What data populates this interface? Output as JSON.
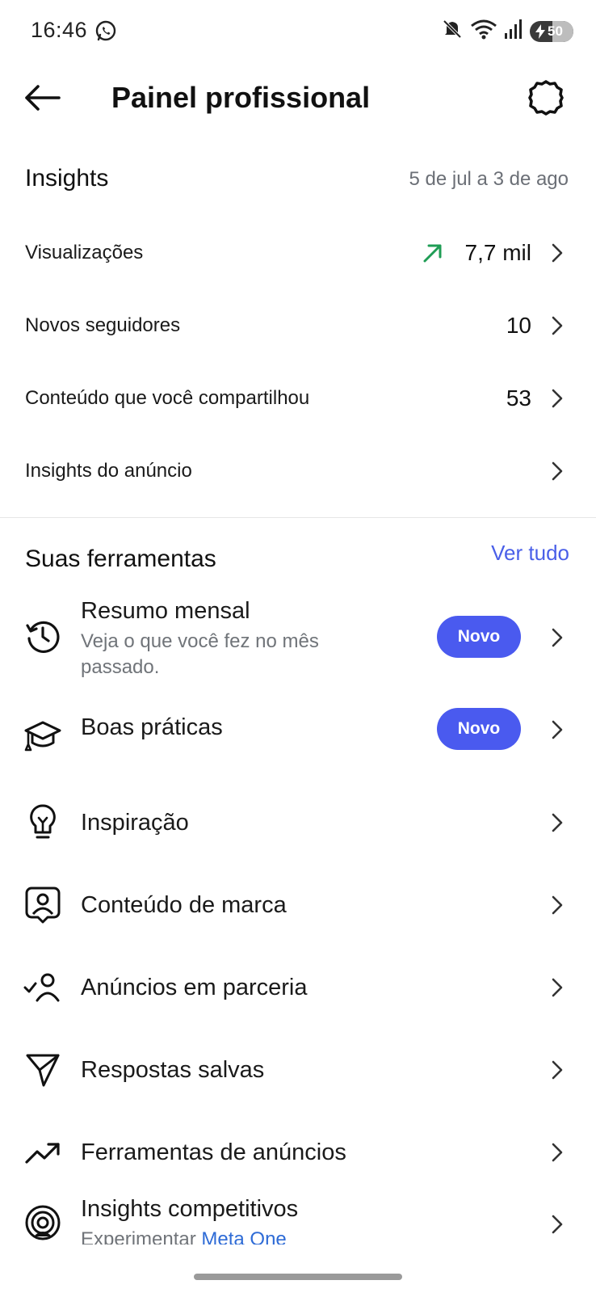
{
  "status": {
    "time": "16:46",
    "battery": "50",
    "icons": [
      "whatsapp-icon",
      "mute-icon",
      "wifi-icon",
      "signal-icon",
      "battery-icon"
    ]
  },
  "header": {
    "title": "Painel profissional",
    "back_icon": "arrow-left-icon",
    "settings_icon": "gear-icon"
  },
  "insights": {
    "title": "Insights",
    "range": "5 de jul a 3 de ago",
    "rows": [
      {
        "label": "Visualizações",
        "value": "7,7 mil",
        "trend": "up"
      },
      {
        "label": "Novos seguidores",
        "value": "10"
      },
      {
        "label": "Conteúdo que você compartilhou",
        "value": "53"
      },
      {
        "label": "Insights do anúncio",
        "value": ""
      }
    ]
  },
  "tools": {
    "title": "Suas ferramentas",
    "see_all": "Ver tudo",
    "items": [
      {
        "label": "Resumo mensal",
        "subtitle": "Veja o que você fez no mês passado.",
        "badge": "Novo",
        "icon": "history-icon"
      },
      {
        "label": "Boas práticas",
        "badge": "Novo",
        "icon": "graduation-cap-icon"
      },
      {
        "label": "Inspiração",
        "icon": "lightbulb-icon"
      },
      {
        "label": "Conteúdo de marca",
        "icon": "branded-content-icon"
      },
      {
        "label": "Anúncios em parceria",
        "icon": "partner-check-icon"
      },
      {
        "label": "Respostas salvas",
        "icon": "send-icon"
      },
      {
        "label": "Ferramentas de anúncios",
        "icon": "trend-up-icon"
      },
      {
        "label": "Insights competitivos",
        "subtitle_prefix": "Experimentar ",
        "subtitle_link": "Meta One",
        "icon": "target-icon"
      }
    ]
  },
  "colors": {
    "accent": "#4a5fe8",
    "badge": "#4a5aef",
    "trend_up": "#1f9d55",
    "muted_text": "#6b6f76"
  }
}
